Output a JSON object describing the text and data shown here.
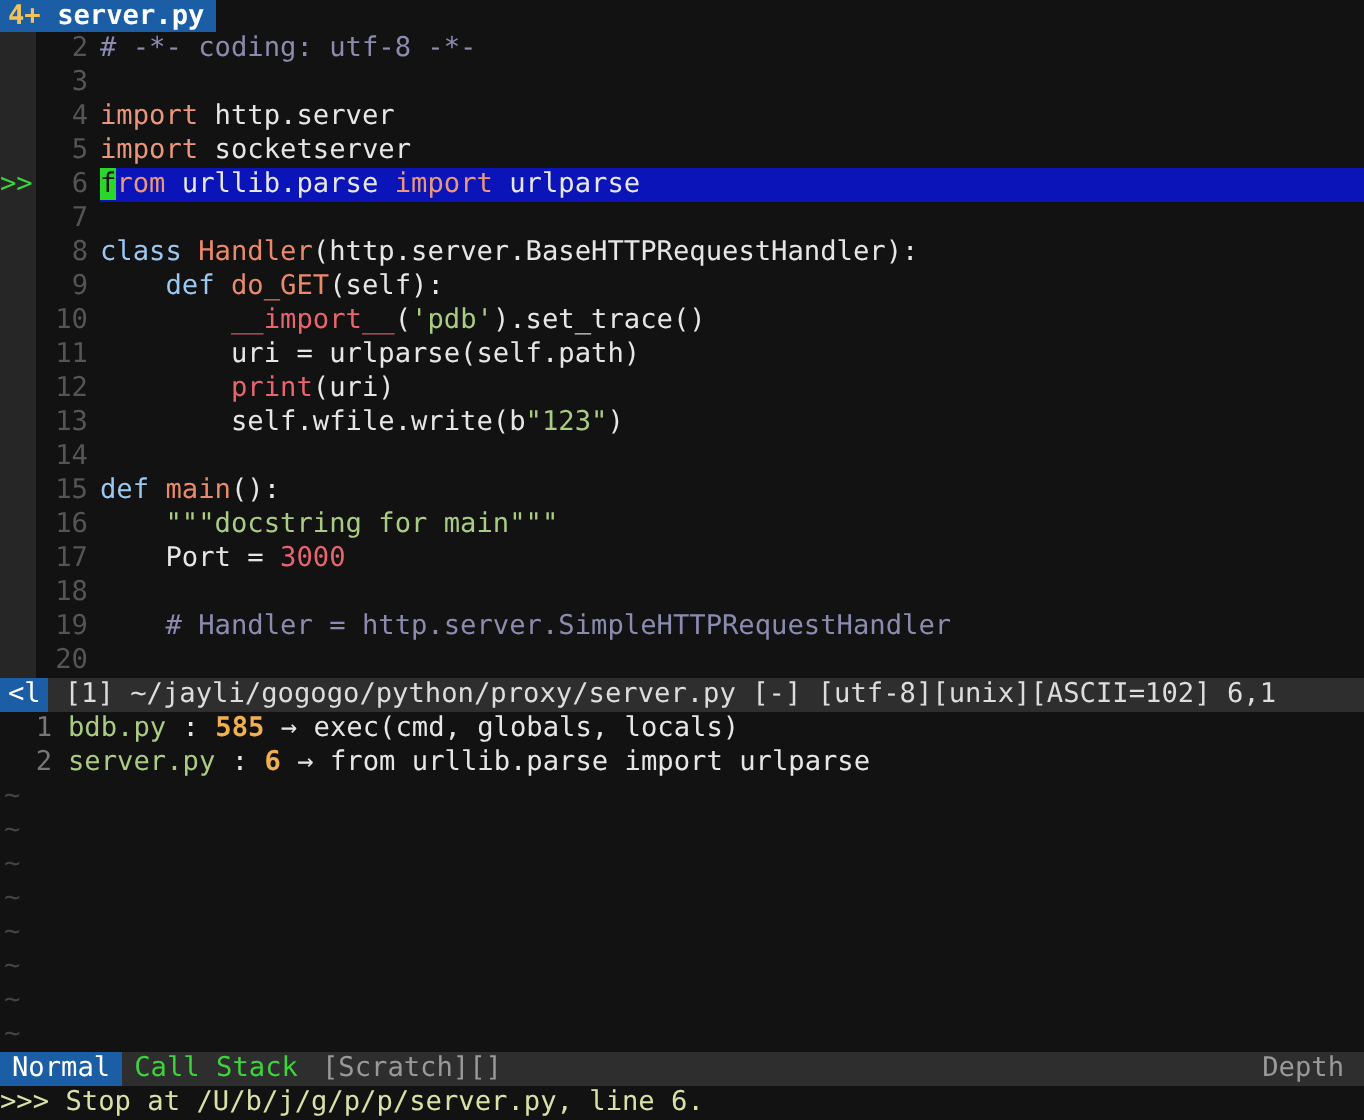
{
  "tabline": {
    "tab": {
      "count": "4+",
      "name": "server.py",
      "selected": true
    }
  },
  "lines": [
    {
      "number": "2",
      "current": false,
      "tokens": [
        {
          "kind": "comment",
          "text": "# -*- coding: utf-8 -*-"
        }
      ]
    },
    {
      "number": "3",
      "current": false
    },
    {
      "number": "4",
      "current": false,
      "tokens": [
        {
          "kind": "keyword",
          "text": "import"
        },
        {
          "kind": "plain",
          "text": " http.server"
        }
      ]
    },
    {
      "number": "5",
      "current": false,
      "tokens": [
        {
          "kind": "keyword",
          "text": "import"
        },
        {
          "kind": "plain",
          "text": " socketserver"
        }
      ]
    },
    {
      "number": "6",
      "current": true,
      "sign": ">>",
      "tokens": [
        {
          "kind": "cursor",
          "text": "f"
        },
        {
          "kind": "keyword",
          "text": "rom"
        },
        {
          "kind": "plain",
          "text": " urllib.parse "
        },
        {
          "kind": "keyword",
          "text": "import"
        },
        {
          "kind": "plain",
          "text": " urlparse"
        }
      ]
    },
    {
      "number": "7",
      "current": false
    },
    {
      "number": "8",
      "current": false,
      "tokens": [
        {
          "kind": "define",
          "text": "class "
        },
        {
          "kind": "name",
          "text": "Handler"
        },
        {
          "kind": "plain",
          "text": "(http.server.BaseHTTPRequestHandler):"
        }
      ]
    },
    {
      "number": "9",
      "current": false,
      "tokens": [
        {
          "kind": "define",
          "text": "    def "
        },
        {
          "kind": "name",
          "text": "do_GET"
        },
        {
          "kind": "plain",
          "text": "(self):"
        }
      ]
    },
    {
      "number": "10",
      "current": false,
      "tokens": [
        {
          "kind": "builtin",
          "text": "        __import__"
        },
        {
          "kind": "plain",
          "text": "("
        },
        {
          "kind": "string",
          "text": "'pdb'"
        },
        {
          "kind": "plain",
          "text": ").set_trace()"
        }
      ]
    },
    {
      "number": "11",
      "current": false,
      "tokens": [
        {
          "kind": "plain",
          "text": "        uri = urlparse(self.path)"
        }
      ]
    },
    {
      "number": "12",
      "current": false,
      "tokens": [
        {
          "kind": "builtin",
          "text": "        print"
        },
        {
          "kind": "plain",
          "text": "(uri)"
        }
      ]
    },
    {
      "number": "13",
      "current": false,
      "tokens": [
        {
          "kind": "plain",
          "text": "        self.wfile.write(b"
        },
        {
          "kind": "string",
          "text": "\"123\""
        },
        {
          "kind": "plain",
          "text": ")"
        }
      ]
    },
    {
      "number": "14",
      "current": false
    },
    {
      "number": "15",
      "current": false,
      "tokens": [
        {
          "kind": "define",
          "text": "def "
        },
        {
          "kind": "name",
          "text": "main"
        },
        {
          "kind": "plain",
          "text": "():"
        }
      ]
    },
    {
      "number": "16",
      "current": false,
      "tokens": [
        {
          "kind": "string",
          "text": "    \"\"\"docstring for main\"\"\""
        }
      ]
    },
    {
      "number": "17",
      "current": false,
      "tokens": [
        {
          "kind": "plain",
          "text": "    Port = "
        },
        {
          "kind": "number",
          "text": "3000"
        }
      ]
    },
    {
      "number": "18",
      "current": false
    },
    {
      "number": "19",
      "current": false,
      "tokens": [
        {
          "kind": "comment",
          "text": "    # Handler = http.server.SimpleHTTPRequestHandler"
        }
      ]
    },
    {
      "number": "20",
      "current": false
    }
  ],
  "file_status": {
    "mode": "<l",
    "text": "[1] ~/jayli/gogogo/python/proxy/server.py [-] [utf-8][unix][ASCII=102] 6,1"
  },
  "call_stack": [
    {
      "number": "1",
      "segments": [
        {
          "kind": "file",
          "text": "bdb.py"
        },
        {
          "kind": "plain",
          "text": " : "
        },
        {
          "kind": "lineno",
          "text": "585"
        },
        {
          "kind": "plain",
          "text": " → exec(cmd, globals, locals)"
        }
      ]
    },
    {
      "number": "2",
      "segments": [
        {
          "kind": "file",
          "text": "server.py"
        },
        {
          "kind": "plain",
          "text": " : "
        },
        {
          "kind": "lineno",
          "text": "6"
        },
        {
          "kind": "plain",
          "text": " → from urllib.parse import urlparse"
        }
      ]
    }
  ],
  "filler_lines": [
    "~",
    "~",
    "~",
    "~",
    "~",
    "~",
    "~",
    "~"
  ],
  "statusline": {
    "mode": "Normal",
    "title": "Call Stack",
    "buffers": "[Scratch][]",
    "right": "Depth"
  },
  "command_line": ">>> Stop at /U/b/j/g/p/p/server.py, line 6."
}
